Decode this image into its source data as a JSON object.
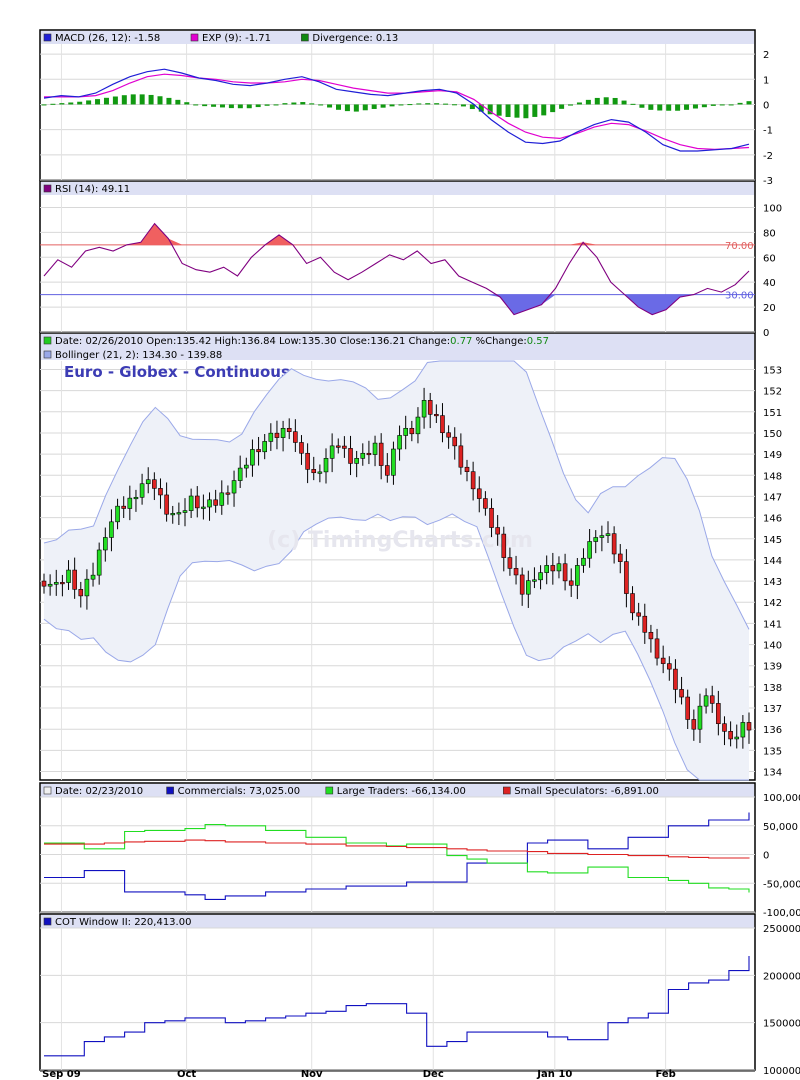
{
  "watermark": "(c) TimingCharts.com",
  "chart_data": [
    {
      "type": "bar",
      "panel": "macd",
      "legend": [
        {
          "swatch": "#1f1fd6",
          "text": "MACD (26, 12): -1.58"
        },
        {
          "swatch": "#e000d0",
          "text": "EXP (9): -1.71"
        },
        {
          "swatch": "#118811",
          "text": "Divergence: 0.13"
        }
      ],
      "ylim": [
        -3,
        2.4
      ],
      "ticks": [
        "2",
        "1",
        "0",
        "-1",
        "-2",
        "-3"
      ],
      "tick_values": [
        2,
        1,
        0,
        -1,
        -2,
        -3
      ],
      "macd": [
        0.25,
        0.35,
        0.3,
        0.45,
        0.8,
        1.1,
        1.3,
        1.4,
        1.25,
        1.05,
        0.95,
        0.8,
        0.75,
        0.85,
        1.0,
        1.1,
        0.9,
        0.6,
        0.5,
        0.4,
        0.35,
        0.45,
        0.55,
        0.6,
        0.45,
        0.0,
        -0.6,
        -1.1,
        -1.5,
        -1.55,
        -1.45,
        -1.1,
        -0.8,
        -0.6,
        -0.7,
        -1.1,
        -1.6,
        -1.85,
        -1.85,
        -1.8,
        -1.75,
        -1.58
      ],
      "exp": [
        0.3,
        0.3,
        0.3,
        0.35,
        0.55,
        0.85,
        1.1,
        1.2,
        1.15,
        1.05,
        1.0,
        0.9,
        0.85,
        0.85,
        0.9,
        1.0,
        0.95,
        0.8,
        0.65,
        0.55,
        0.45,
        0.45,
        0.5,
        0.55,
        0.5,
        0.2,
        -0.3,
        -0.75,
        -1.1,
        -1.3,
        -1.35,
        -1.15,
        -0.9,
        -0.75,
        -0.8,
        -1.05,
        -1.35,
        -1.6,
        -1.75,
        -1.78,
        -1.75,
        -1.71
      ],
      "divergence": [
        0.0,
        0.05,
        0.1,
        0.2,
        0.3,
        0.4,
        0.4,
        0.3,
        0.15,
        -0.05,
        -0.1,
        -0.15,
        -0.15,
        -0.05,
        0.05,
        0.1,
        0.0,
        -0.2,
        -0.3,
        -0.2,
        -0.1,
        0.0,
        0.05,
        0.05,
        0.0,
        -0.2,
        -0.4,
        -0.5,
        -0.55,
        -0.45,
        -0.2,
        0.05,
        0.25,
        0.3,
        0.1,
        -0.2,
        -0.25,
        -0.25,
        -0.15,
        -0.05,
        0.0,
        0.13
      ]
    },
    {
      "type": "line",
      "panel": "rsi",
      "legend": [
        {
          "swatch": "#800080",
          "text": "RSI (14): 49.11"
        }
      ],
      "ylim": [
        0,
        110
      ],
      "ticks": [
        "100",
        "80",
        "60",
        "40",
        "20",
        "0"
      ],
      "tick_values": [
        100,
        80,
        60,
        40,
        20,
        0
      ],
      "upper_line": {
        "value": 70,
        "label": "70.00"
      },
      "lower_line": {
        "value": 30,
        "label": "30.00"
      },
      "rsi": [
        45,
        58,
        52,
        65,
        68,
        65,
        70,
        72,
        87,
        75,
        55,
        50,
        48,
        52,
        45,
        60,
        70,
        78,
        70,
        55,
        60,
        48,
        42,
        48,
        55,
        62,
        58,
        65,
        55,
        58,
        45,
        40,
        35,
        28,
        14,
        18,
        22,
        35,
        55,
        72,
        60,
        40,
        30,
        20,
        14,
        18,
        28,
        30,
        35,
        32,
        38,
        49
      ]
    },
    {
      "type": "candlestick",
      "panel": "price",
      "legend": [
        {
          "swatch": "#22cc22",
          "text": "Date: 02/26/2010",
          "parts": [
            {
              "t": "Date: 02/26/2010  Open:",
              "c": "#000"
            },
            {
              "t": "135.42",
              "c": "#000"
            },
            {
              "t": "  High:",
              "c": "#000"
            },
            {
              "t": "136.84",
              "c": "#000"
            },
            {
              "t": "  Low:",
              "c": "#000"
            },
            {
              "t": "135.30",
              "c": "#000"
            },
            {
              "t": "  Close:",
              "c": "#000"
            },
            {
              "t": "136.21",
              "c": "#000"
            },
            {
              "t": "  Change:",
              "c": "#000"
            },
            {
              "t": "0.77",
              "c": "#118811"
            },
            {
              "t": "  %Change:",
              "c": "#000"
            },
            {
              "t": "0.57",
              "c": "#118811"
            }
          ]
        },
        {
          "swatch": "#9aa8e8",
          "text": "Bollinger (21, 2): 134.30 - 139.88"
        }
      ],
      "legend_line1": "Date: 02/26/2010  Open:135.42  High:136.84  Low:135.30  Close:136.21  Change:",
      "change": "0.77",
      "pct_label": "  %Change:",
      "pct_change": "0.57",
      "title": "Euro - Globex - Continuous",
      "ylim": [
        133.6,
        153.4
      ],
      "ticks": [
        "153",
        "152",
        "151",
        "150",
        "149",
        "148",
        "147",
        "146",
        "145",
        "144",
        "143",
        "142",
        "141",
        "140",
        "139",
        "138",
        "137",
        "136",
        "135",
        "134"
      ],
      "tick_values": [
        153,
        152,
        151,
        150,
        149,
        148,
        147,
        146,
        145,
        144,
        143,
        142,
        141,
        140,
        139,
        138,
        137,
        136,
        135,
        134
      ],
      "close": [
        143.0,
        142.7,
        143.4,
        142.3,
        143.4,
        145.3,
        146.3,
        146.8,
        147.6,
        147.5,
        146.4,
        146.0,
        146.9,
        146.5,
        146.7,
        147.4,
        148.1,
        149.1,
        149.6,
        149.9,
        150.3,
        148.8,
        148.0,
        148.8,
        149.5,
        148.8,
        148.8,
        149.4,
        148.0,
        150.0,
        150.2,
        151.3,
        150.7,
        149.8,
        148.5,
        147.6,
        146.2,
        145.1,
        143.6,
        142.5,
        143.3,
        143.5,
        143.7,
        142.8,
        144.2,
        145.3,
        145.0,
        143.8,
        141.5,
        140.7,
        139.6,
        138.6,
        137.4,
        136.0,
        137.7,
        136.5,
        135.3,
        136.2
      ]
    },
    {
      "type": "line",
      "panel": "cot",
      "legend": [
        {
          "swatch": "#f0f0f0",
          "text": "Date: 02/23/2010"
        },
        {
          "swatch": "#1010c0",
          "text": "Commercials: 73,025.00"
        },
        {
          "swatch": "#22dd22",
          "text": "Large Traders: -66,134.00"
        },
        {
          "swatch": "#dd2222",
          "text": "Small Speculators: -6,891.00"
        }
      ],
      "ylim": [
        -100000,
        100000
      ],
      "ticks": [
        "100,000",
        "50,000",
        "0",
        "-50,000",
        "-100,000"
      ],
      "tick_values": [
        100000,
        50000,
        0,
        -50000,
        -100000
      ],
      "series": [
        {
          "name": "Commercials",
          "color": "#1010c0",
          "values": [
            -40000,
            -40000,
            -28000,
            -28000,
            -65000,
            -65000,
            -65000,
            -70000,
            -78000,
            -72000,
            -72000,
            -65000,
            -65000,
            -60000,
            -60000,
            -55000,
            -55000,
            -55000,
            -48000,
            -48000,
            -48000,
            -15000,
            -15000,
            -15000,
            20000,
            25000,
            25000,
            10000,
            10000,
            30000,
            30000,
            50000,
            50000,
            60000,
            60000,
            73025
          ]
        },
        {
          "name": "Large Traders",
          "color": "#22dd22",
          "values": [
            20000,
            20000,
            10000,
            10000,
            40000,
            42000,
            42000,
            45000,
            52000,
            50000,
            50000,
            42000,
            42000,
            30000,
            30000,
            20000,
            20000,
            15000,
            18000,
            18000,
            -2000,
            -8000,
            -15000,
            -15000,
            -30000,
            -32000,
            -32000,
            -22000,
            -22000,
            -40000,
            -40000,
            -45000,
            -50000,
            -58000,
            -60000,
            -66134
          ]
        },
        {
          "name": "Small Speculators",
          "color": "#dd2222",
          "values": [
            18000,
            18000,
            18000,
            20000,
            22000,
            23000,
            23000,
            25000,
            24000,
            22000,
            22000,
            20000,
            20000,
            18000,
            18000,
            15000,
            15000,
            14000,
            12000,
            12000,
            10000,
            8000,
            6000,
            6000,
            5000,
            2000,
            2000,
            0,
            0,
            -2000,
            -2000,
            -4000,
            -5000,
            -6000,
            -6000,
            -6891
          ]
        }
      ]
    },
    {
      "type": "line",
      "panel": "window",
      "legend": [
        {
          "swatch": "#1010c0",
          "text": "COT Window II: 220,413.00"
        }
      ],
      "ylim": [
        100000,
        250000
      ],
      "ticks": [
        "250000",
        "200000",
        "150000",
        "100000"
      ],
      "tick_values": [
        250000,
        200000,
        150000,
        100000
      ],
      "series": [
        {
          "name": "COT Window II",
          "color": "#1010c0",
          "values": [
            115000,
            115000,
            130000,
            135000,
            140000,
            150000,
            152000,
            155000,
            155000,
            150000,
            152000,
            155000,
            157000,
            160000,
            162000,
            168000,
            170000,
            170000,
            160000,
            125000,
            130000,
            140000,
            140000,
            140000,
            140000,
            135000,
            132000,
            132000,
            150000,
            155000,
            160000,
            185000,
            192000,
            195000,
            205000,
            220413
          ]
        }
      ]
    }
  ],
  "x_axis": {
    "labels": [
      "Sep 09",
      "Oct",
      "Nov",
      "Dec",
      "Jan 10",
      "Feb"
    ],
    "label_fraction": [
      0.03,
      0.205,
      0.38,
      0.55,
      0.72,
      0.875
    ]
  }
}
